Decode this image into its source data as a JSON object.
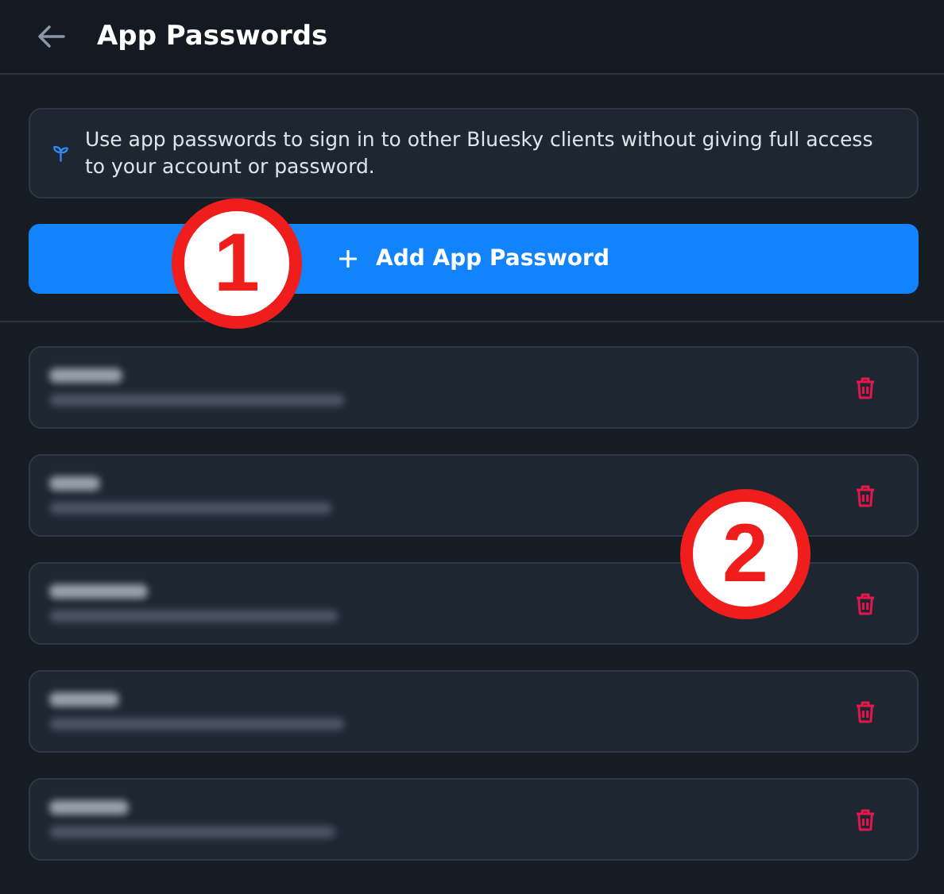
{
  "header": {
    "title": "App Passwords"
  },
  "info": {
    "text": "Use app passwords to sign in to other Bluesky clients without giving full access to your account or password."
  },
  "add_button": {
    "label": "Add App Password"
  },
  "passwords": [
    {
      "kind": "redacted"
    },
    {
      "kind": "redacted"
    },
    {
      "kind": "redacted"
    },
    {
      "kind": "redacted"
    },
    {
      "kind": "redacted"
    }
  ],
  "annotations": [
    {
      "label": "1"
    },
    {
      "label": "2"
    }
  ]
}
